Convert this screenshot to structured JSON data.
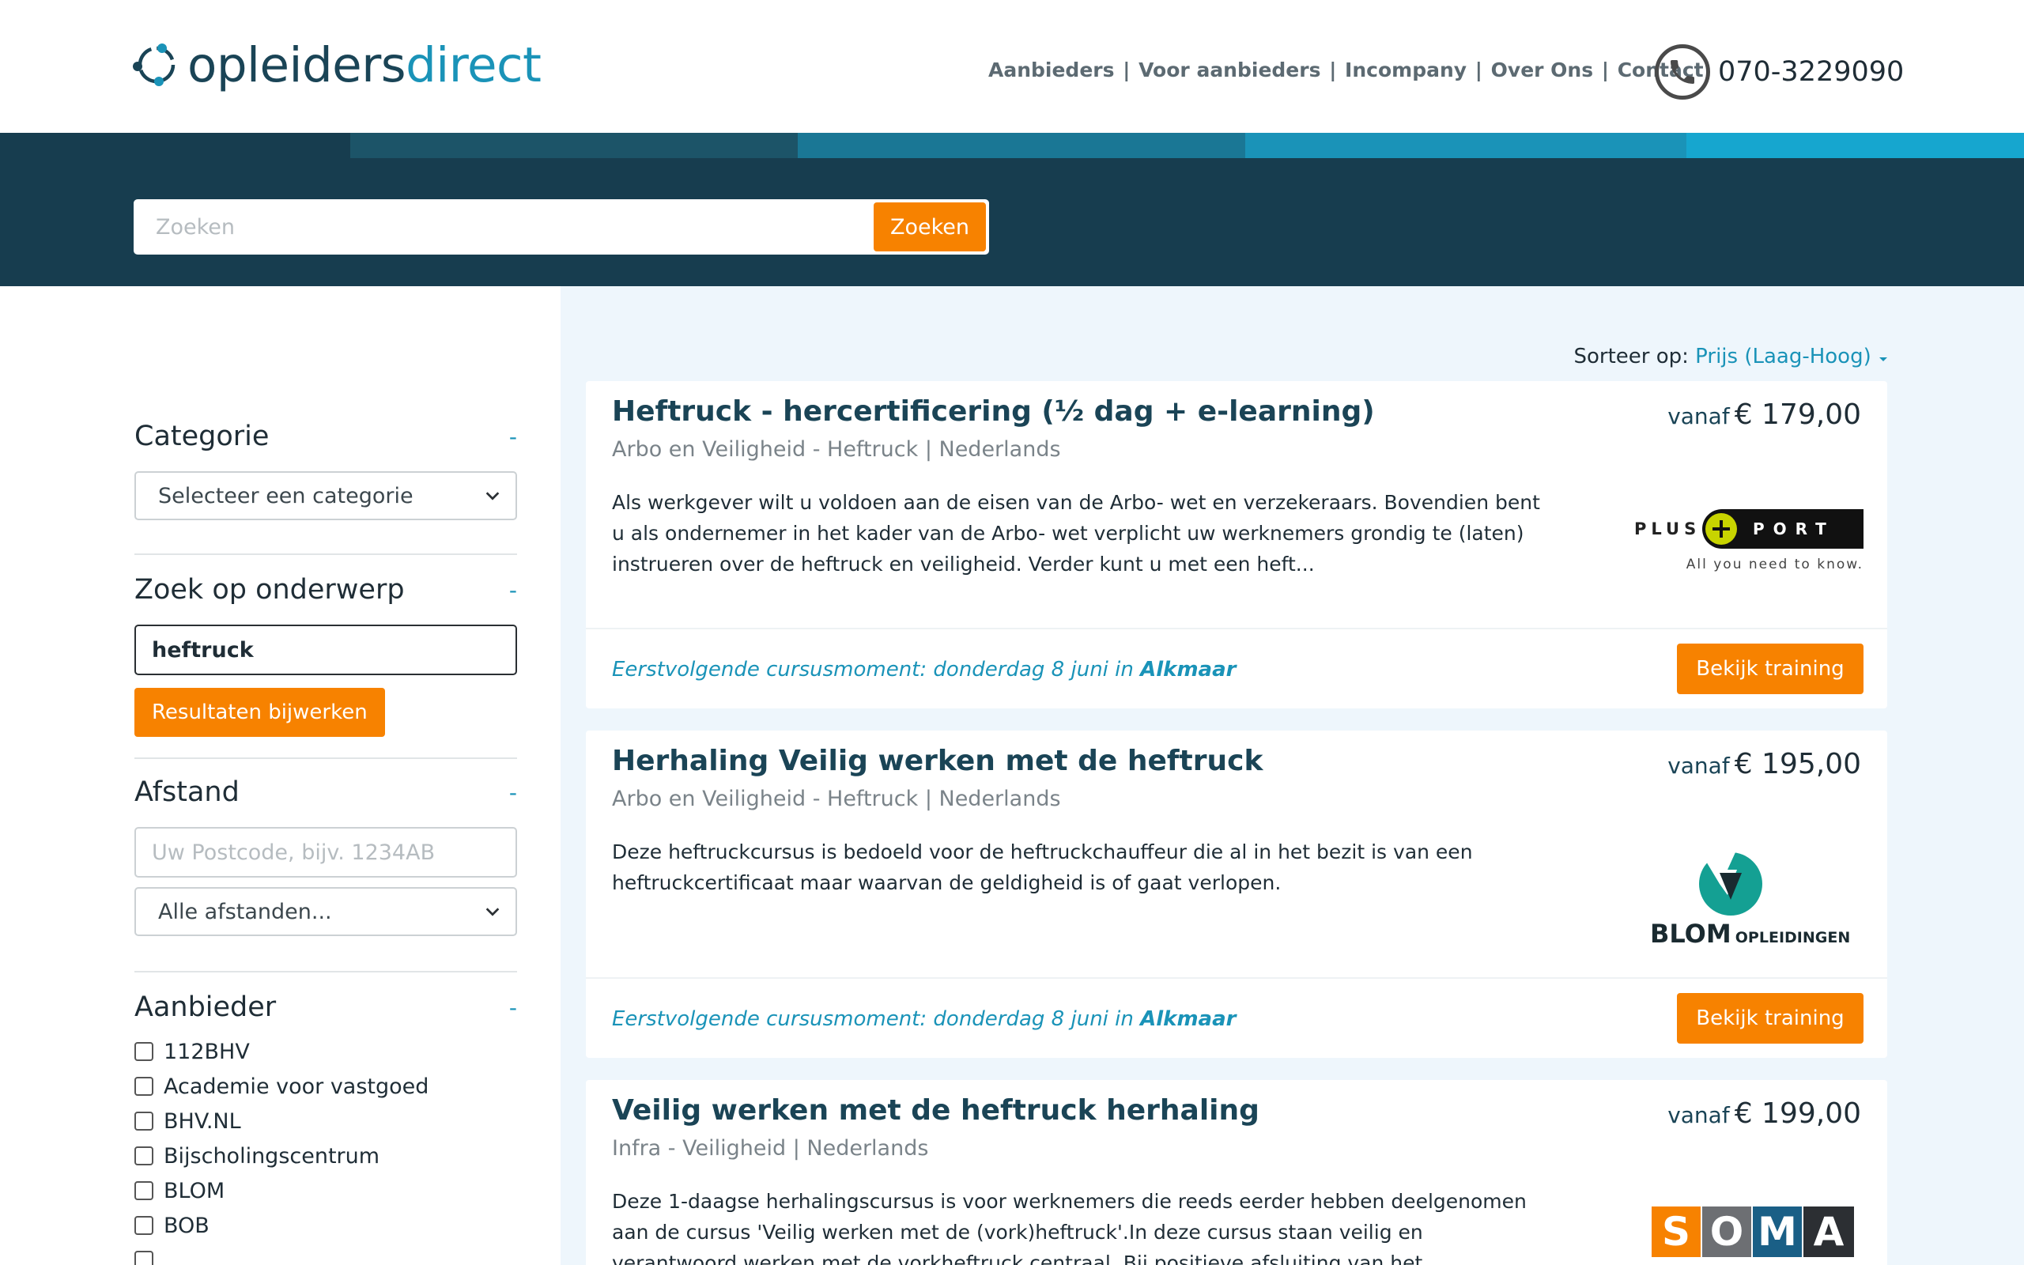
{
  "header": {
    "logo_part1": "opleiders",
    "logo_part2": "direct",
    "nav": [
      "Aanbieders",
      "Voor aanbieders",
      "Incompany",
      "Over Ons",
      "Contact"
    ],
    "phone": "070-3229090"
  },
  "search": {
    "placeholder": "Zoeken",
    "button": "Zoeken"
  },
  "sidebar": {
    "categorie": {
      "title": "Categorie",
      "toggle": "-",
      "select": "Selecteer een categorie"
    },
    "onderwerp": {
      "title": "Zoek op onderwerp",
      "toggle": "-",
      "value": "heftruck",
      "button": "Resultaten bijwerken"
    },
    "afstand": {
      "title": "Afstand",
      "toggle": "-",
      "postcode_placeholder": "Uw Postcode, bijv. 1234AB",
      "select": "Alle afstanden..."
    },
    "aanbieder": {
      "title": "Aanbieder",
      "toggle": "-",
      "items": [
        "112BHV",
        "Academie voor vastgoed",
        "BHV.NL",
        "Bijscholingscentrum",
        "BLOM",
        "BOB"
      ]
    }
  },
  "results": {
    "sort_label": "Sorteer op:",
    "sort_value": "Prijs (Laag-Hoog)",
    "price_prefix": "vanaf",
    "next_prefix": "Eerstvolgende cursusmoment: donderdag 8 juni in",
    "button": "Bekijk training",
    "items": [
      {
        "title": "Heftruck - hercertificering (½ dag + e-learning)",
        "meta": "Arbo en Veiligheid - Heftruck | Nederlands",
        "price": "€ 179,00",
        "description": "Als werkgever wilt u voldoen aan de eisen van de Arbo- wet en verzekeraars. Bovendien bent u als ondernemer in het kader van de Arbo- wet verplicht uw werknemers grondig te (laten) instrueren over de heftruck en veiligheid. Verder kunt u met een heft...",
        "next_city": "Alkmaar",
        "logo_text": "PLUS PORT",
        "logo_tagline": "All you need to know."
      },
      {
        "title": "Herhaling Veilig werken met de heftruck",
        "meta": "Arbo en Veiligheid - Heftruck | Nederlands",
        "price": "€ 195,00",
        "description": "Deze heftruckcursus is bedoeld voor de heftruckchauffeur die al in het bezit is van een heftruckcertificaat maar waarvan de geldigheid is of gaat verlopen.",
        "next_city": "Alkmaar",
        "logo_text": "BLOM",
        "logo_tagline": "OPLEIDINGEN"
      },
      {
        "title": "Veilig werken met de heftruck herhaling",
        "meta": "Infra - Veiligheid | Nederlands",
        "price": "€ 199,00",
        "description": "Deze 1-daagse herhalingscursus is voor werknemers die reeds eerder hebben deelgenomen aan de cursus 'Veilig werken met de (vork)heftruck'.In deze cursus staan veilig en verantwoord werken met de vorkheftruck centraal. Bij positieve afsluiting van het",
        "logo_letters": [
          "S",
          "O",
          "M",
          "A"
        ]
      }
    ]
  },
  "colors": {
    "accent": "#f78200",
    "brand_dark": "#173d4f",
    "brand_light": "#1a93b8"
  }
}
